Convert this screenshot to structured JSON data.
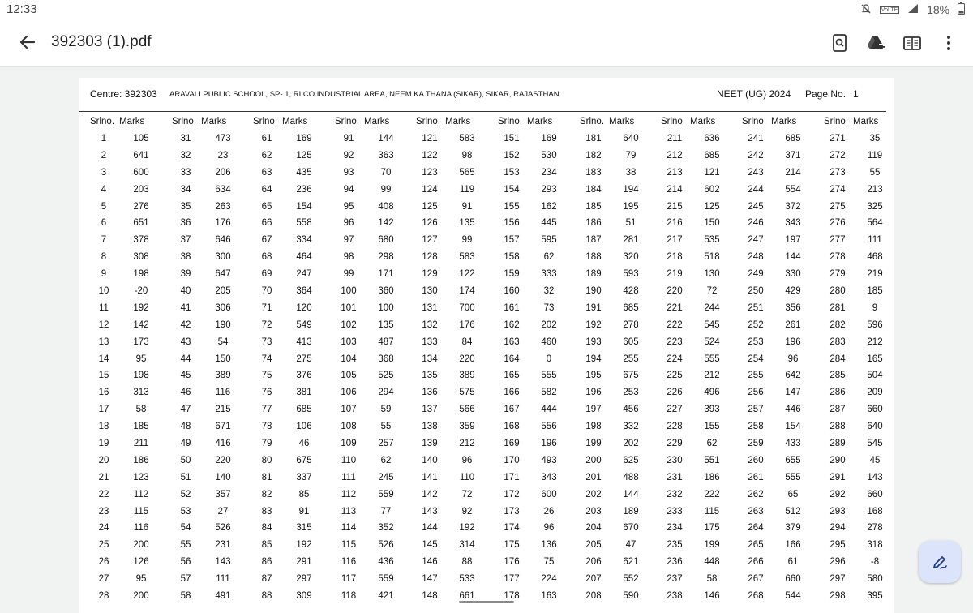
{
  "status": {
    "time": "12:33",
    "battery": "18%",
    "net_badge": "VoLTE"
  },
  "toolbar": {
    "title": "392303 (1).pdf"
  },
  "header": {
    "centre": "Centre: 392303",
    "school": "ARAVALI PUBLIC SCHOOL, SP- 1, RIICO INDUSTRIAL AREA, NEEM KA THANA (SIKAR), SIKAR, RAJASTHAN",
    "exam": "NEET (UG) 2024",
    "page_label": "Page No.",
    "page_no": "1"
  },
  "columns": {
    "srl": "Srlno.",
    "marks": "Marks"
  },
  "table": [
    [
      [
        "1",
        "105"
      ],
      [
        "2",
        "641"
      ],
      [
        "3",
        "600"
      ],
      [
        "4",
        "203"
      ],
      [
        "5",
        "276"
      ],
      [
        "6",
        "651"
      ],
      [
        "7",
        "378"
      ],
      [
        "8",
        "308"
      ],
      [
        "9",
        "198"
      ],
      [
        "10",
        "-20"
      ],
      [
        "11",
        "192"
      ],
      [
        "12",
        "142"
      ],
      [
        "13",
        "173"
      ],
      [
        "14",
        "95"
      ],
      [
        "15",
        "198"
      ],
      [
        "16",
        "313"
      ],
      [
        "17",
        "58"
      ],
      [
        "18",
        "185"
      ],
      [
        "19",
        "211"
      ],
      [
        "20",
        "186"
      ],
      [
        "21",
        "123"
      ],
      [
        "22",
        "112"
      ],
      [
        "23",
        "115"
      ],
      [
        "24",
        "116"
      ],
      [
        "25",
        "200"
      ],
      [
        "26",
        "126"
      ],
      [
        "27",
        "95"
      ],
      [
        "28",
        "200"
      ]
    ],
    [
      [
        "31",
        "473"
      ],
      [
        "32",
        "23"
      ],
      [
        "33",
        "206"
      ],
      [
        "34",
        "634"
      ],
      [
        "35",
        "263"
      ],
      [
        "36",
        "176"
      ],
      [
        "37",
        "646"
      ],
      [
        "38",
        "300"
      ],
      [
        "39",
        "647"
      ],
      [
        "40",
        "205"
      ],
      [
        "41",
        "306"
      ],
      [
        "42",
        "190"
      ],
      [
        "43",
        "54"
      ],
      [
        "44",
        "150"
      ],
      [
        "45",
        "389"
      ],
      [
        "46",
        "116"
      ],
      [
        "47",
        "215"
      ],
      [
        "48",
        "671"
      ],
      [
        "49",
        "416"
      ],
      [
        "50",
        "220"
      ],
      [
        "51",
        "140"
      ],
      [
        "52",
        "357"
      ],
      [
        "53",
        "27"
      ],
      [
        "54",
        "526"
      ],
      [
        "55",
        "231"
      ],
      [
        "56",
        "143"
      ],
      [
        "57",
        "111"
      ],
      [
        "58",
        "491"
      ]
    ],
    [
      [
        "61",
        "169"
      ],
      [
        "62",
        "125"
      ],
      [
        "63",
        "435"
      ],
      [
        "64",
        "236"
      ],
      [
        "65",
        "154"
      ],
      [
        "66",
        "558"
      ],
      [
        "67",
        "334"
      ],
      [
        "68",
        "464"
      ],
      [
        "69",
        "247"
      ],
      [
        "70",
        "364"
      ],
      [
        "71",
        "120"
      ],
      [
        "72",
        "549"
      ],
      [
        "73",
        "413"
      ],
      [
        "74",
        "275"
      ],
      [
        "75",
        "376"
      ],
      [
        "76",
        "381"
      ],
      [
        "77",
        "685"
      ],
      [
        "78",
        "106"
      ],
      [
        "79",
        "46"
      ],
      [
        "80",
        "675"
      ],
      [
        "81",
        "337"
      ],
      [
        "82",
        "85"
      ],
      [
        "83",
        "91"
      ],
      [
        "84",
        "315"
      ],
      [
        "85",
        "192"
      ],
      [
        "86",
        "291"
      ],
      [
        "87",
        "297"
      ],
      [
        "88",
        "309"
      ]
    ],
    [
      [
        "91",
        "144"
      ],
      [
        "92",
        "363"
      ],
      [
        "93",
        "70"
      ],
      [
        "94",
        "99"
      ],
      [
        "95",
        "408"
      ],
      [
        "96",
        "142"
      ],
      [
        "97",
        "680"
      ],
      [
        "98",
        "298"
      ],
      [
        "99",
        "171"
      ],
      [
        "100",
        "360"
      ],
      [
        "101",
        "100"
      ],
      [
        "102",
        "135"
      ],
      [
        "103",
        "487"
      ],
      [
        "104",
        "368"
      ],
      [
        "105",
        "525"
      ],
      [
        "106",
        "294"
      ],
      [
        "107",
        "59"
      ],
      [
        "108",
        "55"
      ],
      [
        "109",
        "257"
      ],
      [
        "110",
        "62"
      ],
      [
        "111",
        "245"
      ],
      [
        "112",
        "559"
      ],
      [
        "113",
        "77"
      ],
      [
        "114",
        "352"
      ],
      [
        "115",
        "526"
      ],
      [
        "116",
        "436"
      ],
      [
        "117",
        "559"
      ],
      [
        "118",
        "421"
      ]
    ],
    [
      [
        "121",
        "583"
      ],
      [
        "122",
        "98"
      ],
      [
        "123",
        "565"
      ],
      [
        "124",
        "119"
      ],
      [
        "125",
        "91"
      ],
      [
        "126",
        "135"
      ],
      [
        "127",
        "99"
      ],
      [
        "128",
        "583"
      ],
      [
        "129",
        "122"
      ],
      [
        "130",
        "174"
      ],
      [
        "131",
        "700"
      ],
      [
        "132",
        "176"
      ],
      [
        "133",
        "84"
      ],
      [
        "134",
        "220"
      ],
      [
        "135",
        "389"
      ],
      [
        "136",
        "575"
      ],
      [
        "137",
        "566"
      ],
      [
        "138",
        "359"
      ],
      [
        "139",
        "212"
      ],
      [
        "140",
        "96"
      ],
      [
        "141",
        "110"
      ],
      [
        "142",
        "72"
      ],
      [
        "143",
        "92"
      ],
      [
        "144",
        "192"
      ],
      [
        "145",
        "314"
      ],
      [
        "146",
        "88"
      ],
      [
        "147",
        "533"
      ],
      [
        "148",
        "661"
      ]
    ],
    [
      [
        "151",
        "169"
      ],
      [
        "152",
        "530"
      ],
      [
        "153",
        "234"
      ],
      [
        "154",
        "293"
      ],
      [
        "155",
        "162"
      ],
      [
        "156",
        "445"
      ],
      [
        "157",
        "595"
      ],
      [
        "158",
        "62"
      ],
      [
        "159",
        "333"
      ],
      [
        "160",
        "32"
      ],
      [
        "161",
        "73"
      ],
      [
        "162",
        "202"
      ],
      [
        "163",
        "460"
      ],
      [
        "164",
        "0"
      ],
      [
        "165",
        "555"
      ],
      [
        "166",
        "582"
      ],
      [
        "167",
        "444"
      ],
      [
        "168",
        "556"
      ],
      [
        "169",
        "196"
      ],
      [
        "170",
        "493"
      ],
      [
        "171",
        "343"
      ],
      [
        "172",
        "600"
      ],
      [
        "173",
        "26"
      ],
      [
        "174",
        "96"
      ],
      [
        "175",
        "136"
      ],
      [
        "176",
        "75"
      ],
      [
        "177",
        "224"
      ],
      [
        "178",
        "163"
      ]
    ],
    [
      [
        "181",
        "640"
      ],
      [
        "182",
        "79"
      ],
      [
        "183",
        "38"
      ],
      [
        "184",
        "194"
      ],
      [
        "185",
        "195"
      ],
      [
        "186",
        "51"
      ],
      [
        "187",
        "281"
      ],
      [
        "188",
        "320"
      ],
      [
        "189",
        "593"
      ],
      [
        "190",
        "428"
      ],
      [
        "191",
        "685"
      ],
      [
        "192",
        "278"
      ],
      [
        "193",
        "605"
      ],
      [
        "194",
        "255"
      ],
      [
        "195",
        "675"
      ],
      [
        "196",
        "253"
      ],
      [
        "197",
        "456"
      ],
      [
        "198",
        "332"
      ],
      [
        "199",
        "202"
      ],
      [
        "200",
        "625"
      ],
      [
        "201",
        "488"
      ],
      [
        "202",
        "144"
      ],
      [
        "203",
        "189"
      ],
      [
        "204",
        "670"
      ],
      [
        "205",
        "47"
      ],
      [
        "206",
        "621"
      ],
      [
        "207",
        "552"
      ],
      [
        "208",
        "590"
      ]
    ],
    [
      [
        "211",
        "636"
      ],
      [
        "212",
        "685"
      ],
      [
        "213",
        "121"
      ],
      [
        "214",
        "602"
      ],
      [
        "215",
        "125"
      ],
      [
        "216",
        "150"
      ],
      [
        "217",
        "535"
      ],
      [
        "218",
        "518"
      ],
      [
        "219",
        "130"
      ],
      [
        "220",
        "72"
      ],
      [
        "221",
        "244"
      ],
      [
        "222",
        "545"
      ],
      [
        "223",
        "524"
      ],
      [
        "224",
        "555"
      ],
      [
        "225",
        "212"
      ],
      [
        "226",
        "496"
      ],
      [
        "227",
        "393"
      ],
      [
        "228",
        "155"
      ],
      [
        "229",
        "62"
      ],
      [
        "230",
        "551"
      ],
      [
        "231",
        "186"
      ],
      [
        "232",
        "222"
      ],
      [
        "233",
        "115"
      ],
      [
        "234",
        "175"
      ],
      [
        "235",
        "199"
      ],
      [
        "236",
        "448"
      ],
      [
        "237",
        "58"
      ],
      [
        "238",
        "146"
      ]
    ],
    [
      [
        "241",
        "685"
      ],
      [
        "242",
        "371"
      ],
      [
        "243",
        "214"
      ],
      [
        "244",
        "554"
      ],
      [
        "245",
        "372"
      ],
      [
        "246",
        "343"
      ],
      [
        "247",
        "197"
      ],
      [
        "248",
        "144"
      ],
      [
        "249",
        "330"
      ],
      [
        "250",
        "429"
      ],
      [
        "251",
        "356"
      ],
      [
        "252",
        "261"
      ],
      [
        "253",
        "196"
      ],
      [
        "254",
        "96"
      ],
      [
        "255",
        "642"
      ],
      [
        "256",
        "147"
      ],
      [
        "257",
        "446"
      ],
      [
        "258",
        "154"
      ],
      [
        "259",
        "433"
      ],
      [
        "260",
        "655"
      ],
      [
        "261",
        "555"
      ],
      [
        "262",
        "65"
      ],
      [
        "263",
        "512"
      ],
      [
        "264",
        "379"
      ],
      [
        "265",
        "166"
      ],
      [
        "266",
        "61"
      ],
      [
        "267",
        "660"
      ],
      [
        "268",
        "544"
      ]
    ],
    [
      [
        "271",
        "35"
      ],
      [
        "272",
        "119"
      ],
      [
        "273",
        "55"
      ],
      [
        "274",
        "213"
      ],
      [
        "275",
        "325"
      ],
      [
        "276",
        "564"
      ],
      [
        "277",
        "111"
      ],
      [
        "278",
        "468"
      ],
      [
        "279",
        "219"
      ],
      [
        "280",
        "185"
      ],
      [
        "281",
        "9"
      ],
      [
        "282",
        "596"
      ],
      [
        "283",
        "212"
      ],
      [
        "284",
        "165"
      ],
      [
        "285",
        "504"
      ],
      [
        "286",
        "209"
      ],
      [
        "287",
        "660"
      ],
      [
        "288",
        "640"
      ],
      [
        "289",
        "545"
      ],
      [
        "290",
        "45"
      ],
      [
        "291",
        "143"
      ],
      [
        "292",
        "660"
      ],
      [
        "293",
        "168"
      ],
      [
        "294",
        "278"
      ],
      [
        "295",
        "318"
      ],
      [
        "296",
        "-8"
      ],
      [
        "297",
        "580"
      ],
      [
        "298",
        "395"
      ]
    ]
  ]
}
